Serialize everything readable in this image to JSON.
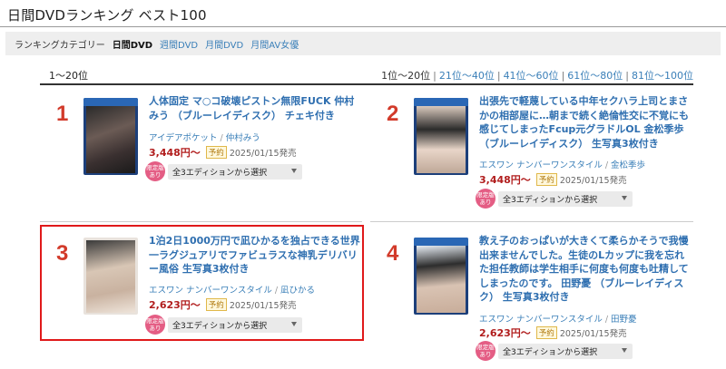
{
  "page": {
    "title": "日間DVDランキング ベスト100"
  },
  "category_bar": {
    "label": "ランキングカテゴリー",
    "items": [
      {
        "label": "日間DVD",
        "active": true
      },
      {
        "label": "週間DVD",
        "active": false
      },
      {
        "label": "月間DVD",
        "active": false
      },
      {
        "label": "月間AV女優",
        "active": false
      }
    ]
  },
  "range": {
    "current": "1〜20位",
    "links": [
      "1位〜20位",
      "21位〜40位",
      "41位〜60位",
      "61位〜80位",
      "81位〜100位"
    ]
  },
  "edition_badge": {
    "line1": "限定版",
    "line2": "あり"
  },
  "items": [
    {
      "rank": "1",
      "title": "人体固定 マ○コ破壊ピストン無限FUCK 仲村みう （ブルーレイディスク） チェキ付き",
      "label": "アイデアポケット",
      "actress": "仲村みう",
      "price": "3,448円〜",
      "status": "予約",
      "release": "2025/01/15発売",
      "edition_select": "全3エディションから選択"
    },
    {
      "rank": "2",
      "title": "出張先で軽蔑している中年セクハラ上司とまさかの相部屋に…朝まで続く絶倫性交に不覚にも感じてしまったFcup元グラドルOL 金松季歩 （ブルーレイディスク） 生写真3枚付き",
      "label": "エスワン ナンバーワンスタイル",
      "actress": "金松季歩",
      "price": "3,448円〜",
      "status": "予約",
      "release": "2025/01/15発売",
      "edition_select": "全3エディションから選択"
    },
    {
      "rank": "3",
      "title": "1泊2日1000万円で凪ひかるを独占できる世界一ラグジュアリでファビュラスな神乳デリバリー風俗 生写真3枚付き",
      "label": "エスワン ナンバーワンスタイル",
      "actress": "凪ひかる",
      "price": "2,623円〜",
      "status": "予約",
      "release": "2025/01/15発売",
      "edition_select": "全3エディションから選択"
    },
    {
      "rank": "4",
      "title": "教え子のおっぱいが大きくて柔らかそうで我慢出来ませんでした。生徒のLカップに我を忘れた担任教師は学生相手に何度も何度も吐精してしまったのです。 田野憂 （ブルーレイディスク） 生写真3枚付き",
      "label": "エスワン ナンバーワンスタイル",
      "actress": "田野憂",
      "price": "2,623円〜",
      "status": "予約",
      "release": "2025/01/15発売",
      "edition_select": "全3エディションから選択"
    }
  ]
}
